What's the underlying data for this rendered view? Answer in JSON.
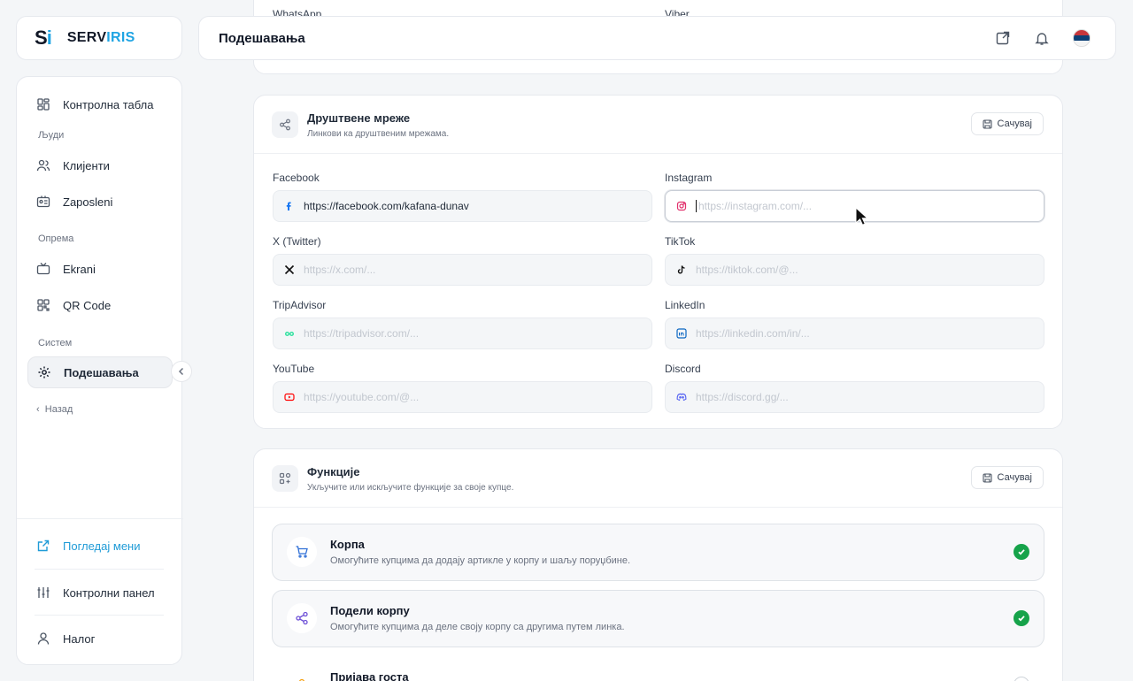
{
  "brand": {
    "mark_s": "S",
    "mark_i": "i",
    "name_a": "SERV",
    "name_b": "IRIS"
  },
  "header": {
    "title": "Подешавања"
  },
  "sidebar": {
    "items": [
      {
        "label": "Контролна табла"
      },
      {
        "label": "Клијенти"
      },
      {
        "label": "Zaposleni"
      },
      {
        "label": "Ekrani"
      },
      {
        "label": "QR Code"
      },
      {
        "label": "Подешавања"
      }
    ],
    "sections": {
      "people": "Људи",
      "equipment": "Опрема",
      "system": "Систем"
    },
    "back": "Назад",
    "bottom": [
      {
        "label": "Погледај мени"
      },
      {
        "label": "Контролни панел"
      },
      {
        "label": "Налог"
      }
    ]
  },
  "top_card": {
    "left_label": "WhatsApp",
    "right_label": "Viber"
  },
  "social": {
    "title": "Друштвене мреже",
    "subtitle": "Линкови ка друштвеним мрежама.",
    "save": "Сачувај",
    "fields": [
      {
        "label": "Facebook",
        "value": "https://facebook.com/kafana-dunav",
        "placeholder": ""
      },
      {
        "label": "Instagram",
        "value": "",
        "placeholder": "https://instagram.com/..."
      },
      {
        "label": "X (Twitter)",
        "value": "",
        "placeholder": "https://x.com/..."
      },
      {
        "label": "TikTok",
        "value": "",
        "placeholder": "https://tiktok.com/@..."
      },
      {
        "label": "TripAdvisor",
        "value": "",
        "placeholder": "https://tripadvisor.com/..."
      },
      {
        "label": "LinkedIn",
        "value": "",
        "placeholder": "https://linkedin.com/in/..."
      },
      {
        "label": "YouTube",
        "value": "",
        "placeholder": "https://youtube.com/@..."
      },
      {
        "label": "Discord",
        "value": "",
        "placeholder": "https://discord.gg/..."
      }
    ]
  },
  "features": {
    "title": "Функције",
    "subtitle": "Укључите или искључите функције за своје купце.",
    "save": "Сачувај",
    "items": [
      {
        "title": "Корпа",
        "desc": "Омогућите купцима да додају артикле у корпу и шаљу поруџбине.",
        "enabled": true
      },
      {
        "title": "Подели корпу",
        "desc": "Омогућите купцима да деле своју корпу са другима путем линка.",
        "enabled": true
      },
      {
        "title": "Пријава госта",
        "desc": "",
        "enabled": false
      }
    ]
  },
  "colors": {
    "accent": "#1fa4e3",
    "success": "#16a34a",
    "instagram": "#e1306c",
    "youtube": "#ff0000",
    "tripadvisor": "#34e0a1",
    "linkedin": "#0a66c2",
    "discord": "#5865f2",
    "facebook": "#1877f2"
  },
  "icons": [
    "dashboard-icon",
    "users-icon",
    "id-card-icon",
    "tv-icon",
    "qr-icon",
    "gear-icon",
    "external-link-icon",
    "bell-icon",
    "flag-serbia",
    "share-icon",
    "save-icon",
    "cart-icon",
    "sliders-icon",
    "user-icon"
  ]
}
